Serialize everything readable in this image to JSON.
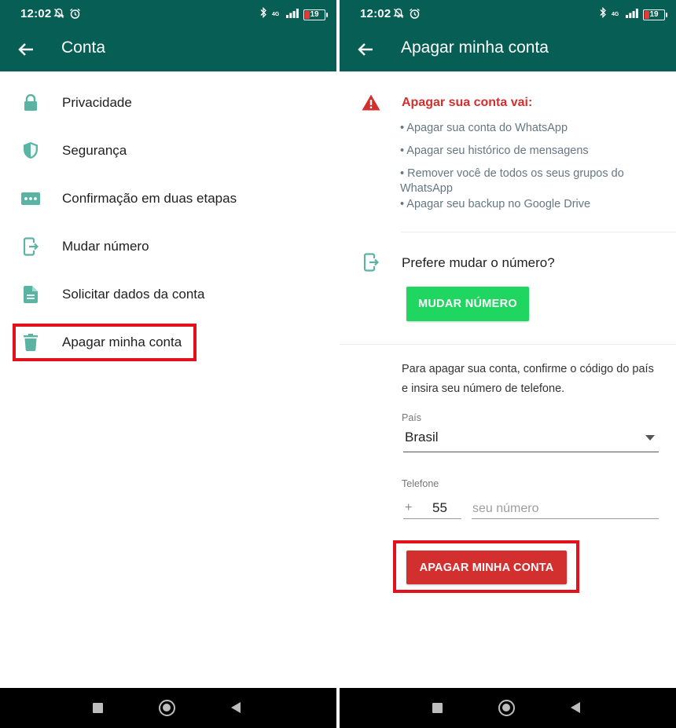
{
  "status_bar": {
    "time": "12:02",
    "network": "4G",
    "battery": "19",
    "battery_level": 0.19
  },
  "left_screen": {
    "title": "Conta",
    "items": [
      {
        "label": "Privacidade",
        "icon": "lock-icon"
      },
      {
        "label": "Segurança",
        "icon": "shield-icon"
      },
      {
        "label": "Confirmação em duas etapas",
        "icon": "dots-icon"
      },
      {
        "label": "Mudar número",
        "icon": "change-number-icon"
      },
      {
        "label": "Solicitar dados da conta",
        "icon": "document-icon"
      },
      {
        "label": "Apagar minha conta",
        "icon": "trash-icon"
      }
    ]
  },
  "right_screen": {
    "title": "Apagar minha conta",
    "warning_title": "Apagar sua conta vai:",
    "bullets": [
      "• Apagar sua conta do WhatsApp",
      "• Apagar seu histórico de mensagens",
      "• Remover você de todos os seus grupos do WhatsApp",
      "• Apagar seu backup no Google Drive"
    ],
    "change_number_prompt": "Prefere mudar o número?",
    "change_number_button": "MUDAR NÚMERO",
    "confirm_text": "Para apagar sua conta, confirme o código do país e insira seu número de telefone.",
    "country_label": "País",
    "country_value": "Brasil",
    "phone_label": "Telefone",
    "plus": "+",
    "country_code": "55",
    "phone_placeholder": "seu número",
    "delete_button": "APAGAR MINHA CONTA"
  },
  "colors": {
    "header": "#075e54",
    "icon": "#5bb3a3",
    "highlight": "#e3111b",
    "green_button": "#1fd660",
    "red_button": "#d32f2f"
  }
}
